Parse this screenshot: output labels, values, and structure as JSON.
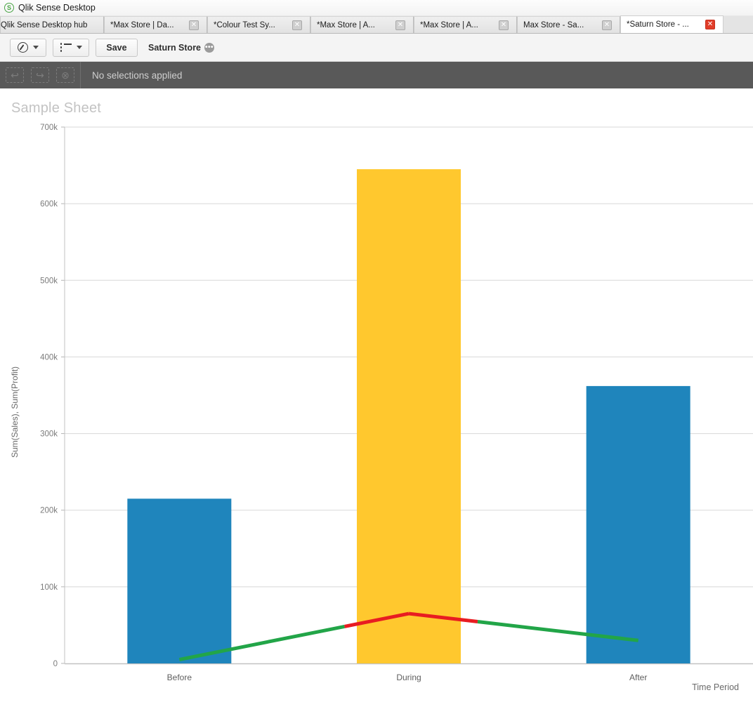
{
  "window": {
    "title": "Qlik Sense Desktop",
    "logo_icon": "qlik-logo-icon",
    "logo_glyph": "S"
  },
  "tabs": [
    {
      "label": "Qlik Sense Desktop hub",
      "closable": false,
      "active": false
    },
    {
      "label": "*Max Store | Da...",
      "closable": true,
      "active": false,
      "close_glyph": "✕"
    },
    {
      "label": "*Colour Test Sy...",
      "closable": true,
      "active": false,
      "close_glyph": "✕"
    },
    {
      "label": "*Max Store | A...",
      "closable": true,
      "active": false,
      "close_glyph": "✕"
    },
    {
      "label": "*Max Store | A...",
      "closable": true,
      "active": false,
      "close_glyph": "✕"
    },
    {
      "label": "Max Store - Sa...",
      "closable": true,
      "active": false,
      "close_glyph": "✕"
    },
    {
      "label": "*Saturn Store - ...",
      "closable": true,
      "active": true,
      "close_glyph": "✕"
    }
  ],
  "toolbar": {
    "nav_icon": "compass-icon",
    "nav_caret_icon": "chevron-down-icon",
    "sheets_icon": "sheet-list-icon",
    "sheets_caret_icon": "chevron-down-icon",
    "save_label": "Save",
    "app_name": "Saturn Store",
    "app_menu_icon": "ellipsis-circle-icon",
    "app_menu_glyph": "•••"
  },
  "selections": {
    "back_icon": "selection-back-icon",
    "back_glyph": "↩",
    "forward_icon": "selection-forward-icon",
    "forward_glyph": "↪",
    "clear_icon": "selection-clear-icon",
    "clear_glyph": "⊗",
    "status": "No selections applied"
  },
  "sheet": {
    "title": "Sample Sheet"
  },
  "chart_data": {
    "type": "bar",
    "title": "",
    "subtitle": "",
    "xlabel": "Time Period",
    "ylabel": "Sum(Sales), Sum(Profit)",
    "categories": [
      "Before",
      "During",
      "After"
    ],
    "ylim": [
      0,
      700000
    ],
    "ytick_labels": [
      "0",
      "100k",
      "200k",
      "300k",
      "400k",
      "500k",
      "600k",
      "700k"
    ],
    "ytick_values": [
      0,
      100000,
      200000,
      300000,
      400000,
      500000,
      600000,
      700000
    ],
    "grid": true,
    "legend": "none",
    "series": [
      {
        "name": "Sum(Sales)",
        "chart_type": "bar",
        "values": [
          215000,
          645000,
          362000
        ],
        "colors": [
          "#1f85bc",
          "#ffc82e",
          "#1f85bc"
        ]
      },
      {
        "name": "Sum(Profit)",
        "chart_type": "line",
        "values": [
          5000,
          65000,
          30000
        ],
        "segment_colors": [
          "#22a548",
          "#e81c21",
          "#e81c21",
          "#22a548"
        ],
        "line_color_positive": "#22a548",
        "line_color_negative": "#e81c21"
      }
    ]
  }
}
